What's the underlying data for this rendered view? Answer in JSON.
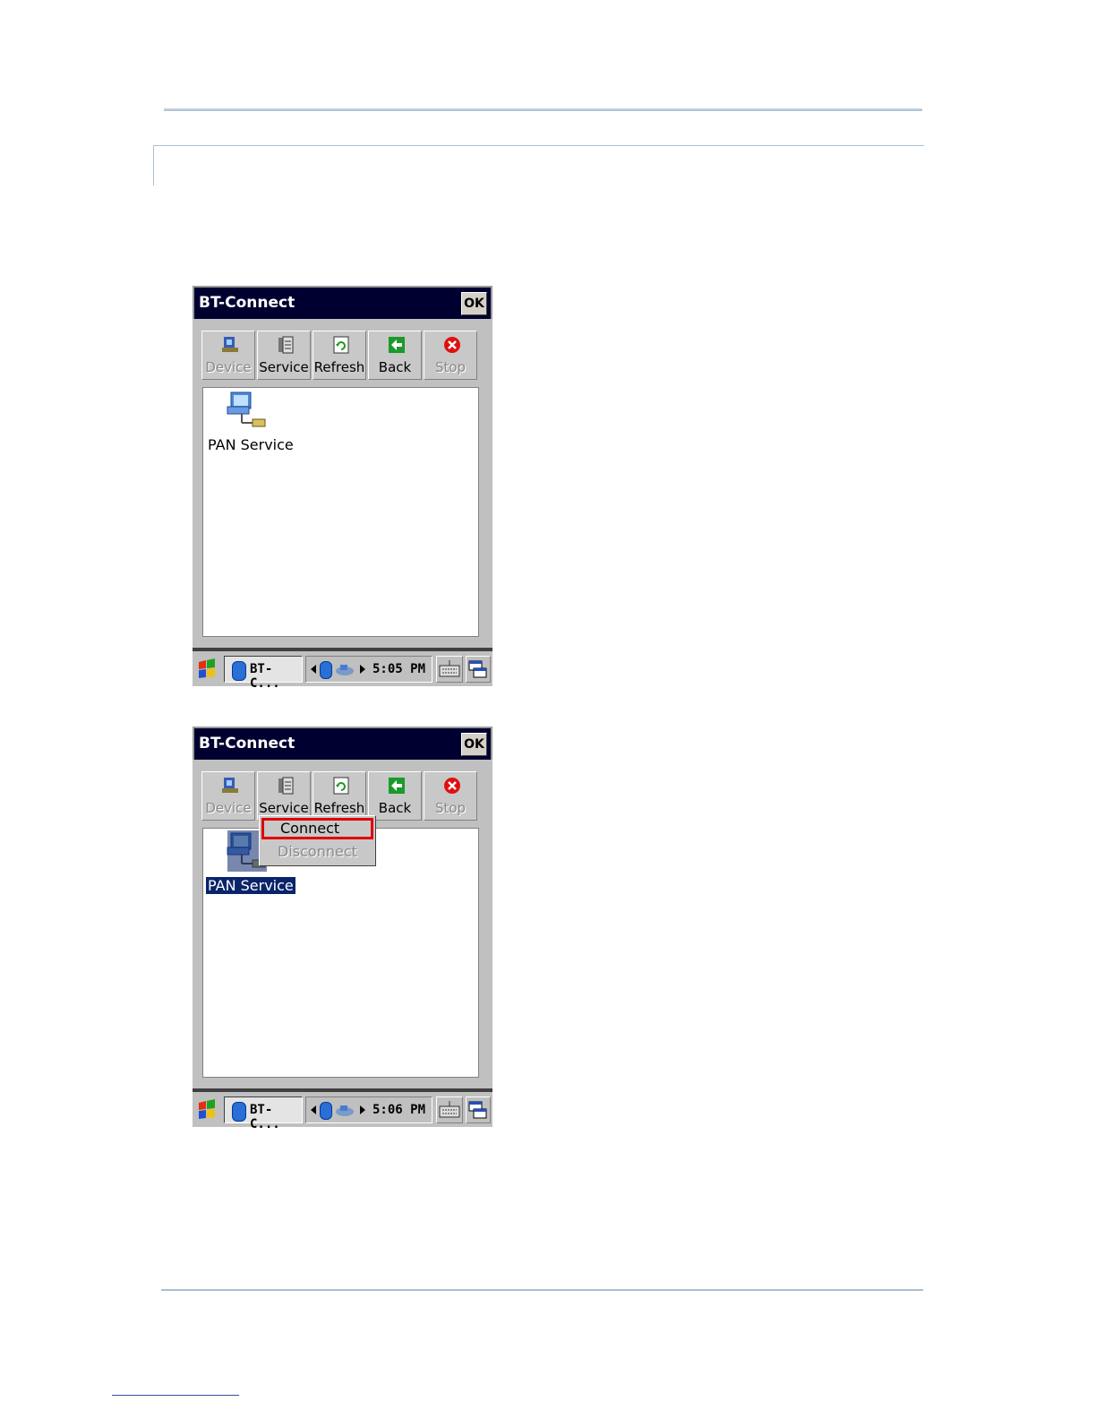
{
  "screens": [
    {
      "title": "BT-Connect",
      "ok_label": "OK",
      "toolbar": [
        {
          "label": "Device",
          "icon": "device-icon",
          "enabled": false
        },
        {
          "label": "Service",
          "icon": "service-icon",
          "enabled": true
        },
        {
          "label": "Refresh",
          "icon": "refresh-icon",
          "enabled": true
        },
        {
          "label": "Back",
          "icon": "back-arrow-icon",
          "enabled": true
        },
        {
          "label": "Stop",
          "icon": "stop-icon",
          "enabled": false
        }
      ],
      "item_label": "PAN Service",
      "taskbar": {
        "app_label": "BT-C...",
        "clock": "5:05 PM"
      }
    },
    {
      "title": "BT-Connect",
      "ok_label": "OK",
      "toolbar": [
        {
          "label": "Device",
          "icon": "device-icon",
          "enabled": false
        },
        {
          "label": "Service",
          "icon": "service-icon",
          "enabled": true
        },
        {
          "label": "Refresh",
          "icon": "refresh-icon",
          "enabled": true
        },
        {
          "label": "Back",
          "icon": "back-arrow-icon",
          "enabled": true
        },
        {
          "label": "Stop",
          "icon": "stop-icon",
          "enabled": false
        }
      ],
      "item_label": "PAN Service",
      "context_menu": {
        "connect": "Connect",
        "disconnect": "Disconnect"
      },
      "taskbar": {
        "app_label": "BT-C...",
        "clock": "5:06 PM"
      }
    }
  ],
  "colors": {
    "titlebar": "#000030",
    "selection": "#0a246a",
    "highlight_box": "#e00000",
    "rule": "#a9bfd1"
  }
}
